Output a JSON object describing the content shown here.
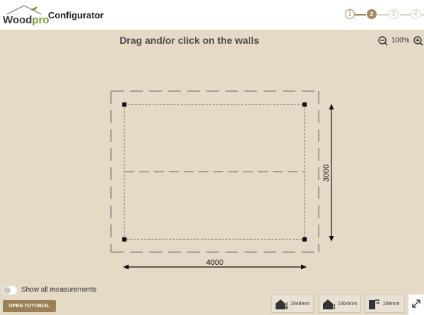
{
  "header": {
    "logo_left": "Wood",
    "logo_right": "pro",
    "app_title": "Configurator",
    "steps": [
      {
        "label": "1",
        "state": "done"
      },
      {
        "label": "2",
        "state": "active"
      },
      {
        "label": "3",
        "state": "todo"
      },
      {
        "label": "4",
        "state": "todo"
      }
    ]
  },
  "canvas": {
    "instruction": "Drag and/or click on the walls",
    "zoom_level": "100%",
    "width_label": "4000",
    "depth_label": "3000"
  },
  "footer": {
    "show_measurements_label": "Show all measurements",
    "show_measurements_on": false,
    "tutorial_button": "OPEN TUTORIAL",
    "measurements": [
      {
        "icon": "house-height-icon",
        "value": "2949mm"
      },
      {
        "icon": "house-eave-height-icon",
        "value": "2364mm"
      },
      {
        "icon": "overhang-icon",
        "value": "298mm"
      }
    ]
  },
  "colors": {
    "background": "#e5dac6",
    "accent": "#a68a5d",
    "button": "#9b7f55",
    "logo_green": "#7a9b3a"
  }
}
